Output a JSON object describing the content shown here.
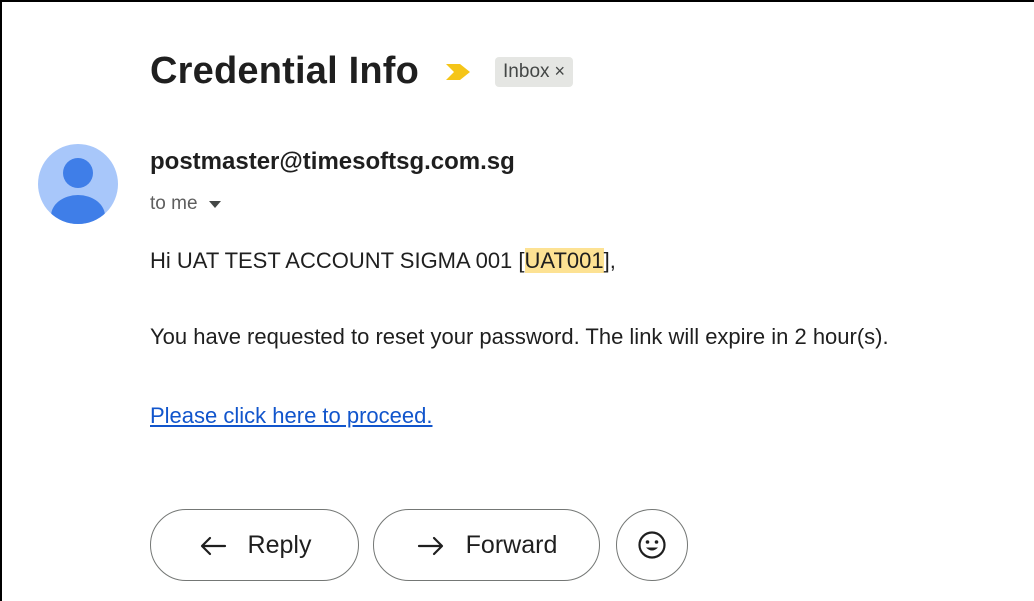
{
  "email": {
    "subject": "Credential Info",
    "label": {
      "text": "Inbox",
      "close": "×"
    },
    "sender": "postmaster@timesoftsg.com.sg",
    "recipient": "to me",
    "greeting": {
      "prefix": "Hi UAT TEST ACCOUNT SIGMA 001 [",
      "code": "UAT001",
      "suffix": "],"
    },
    "message": "You have requested to reset your password. The link will expire in 2 hour(s).",
    "link_text": "Please click here to proceed."
  },
  "actions": {
    "reply_label": "Reply",
    "forward_label": "Forward"
  },
  "icons": {
    "importance": "importance-marker-icon",
    "avatar": "person-icon",
    "caret": "caret-down-icon",
    "reply": "reply-arrow-icon",
    "forward": "forward-arrow-icon",
    "emoji": "smiley-icon"
  },
  "colors": {
    "importance_marker": "#f5c518",
    "avatar_bg": "#a8c7fa",
    "avatar_fg": "#3f7ee8",
    "highlight": "#fde293",
    "link": "#1155cc",
    "chip_bg": "#e5e6e3"
  }
}
